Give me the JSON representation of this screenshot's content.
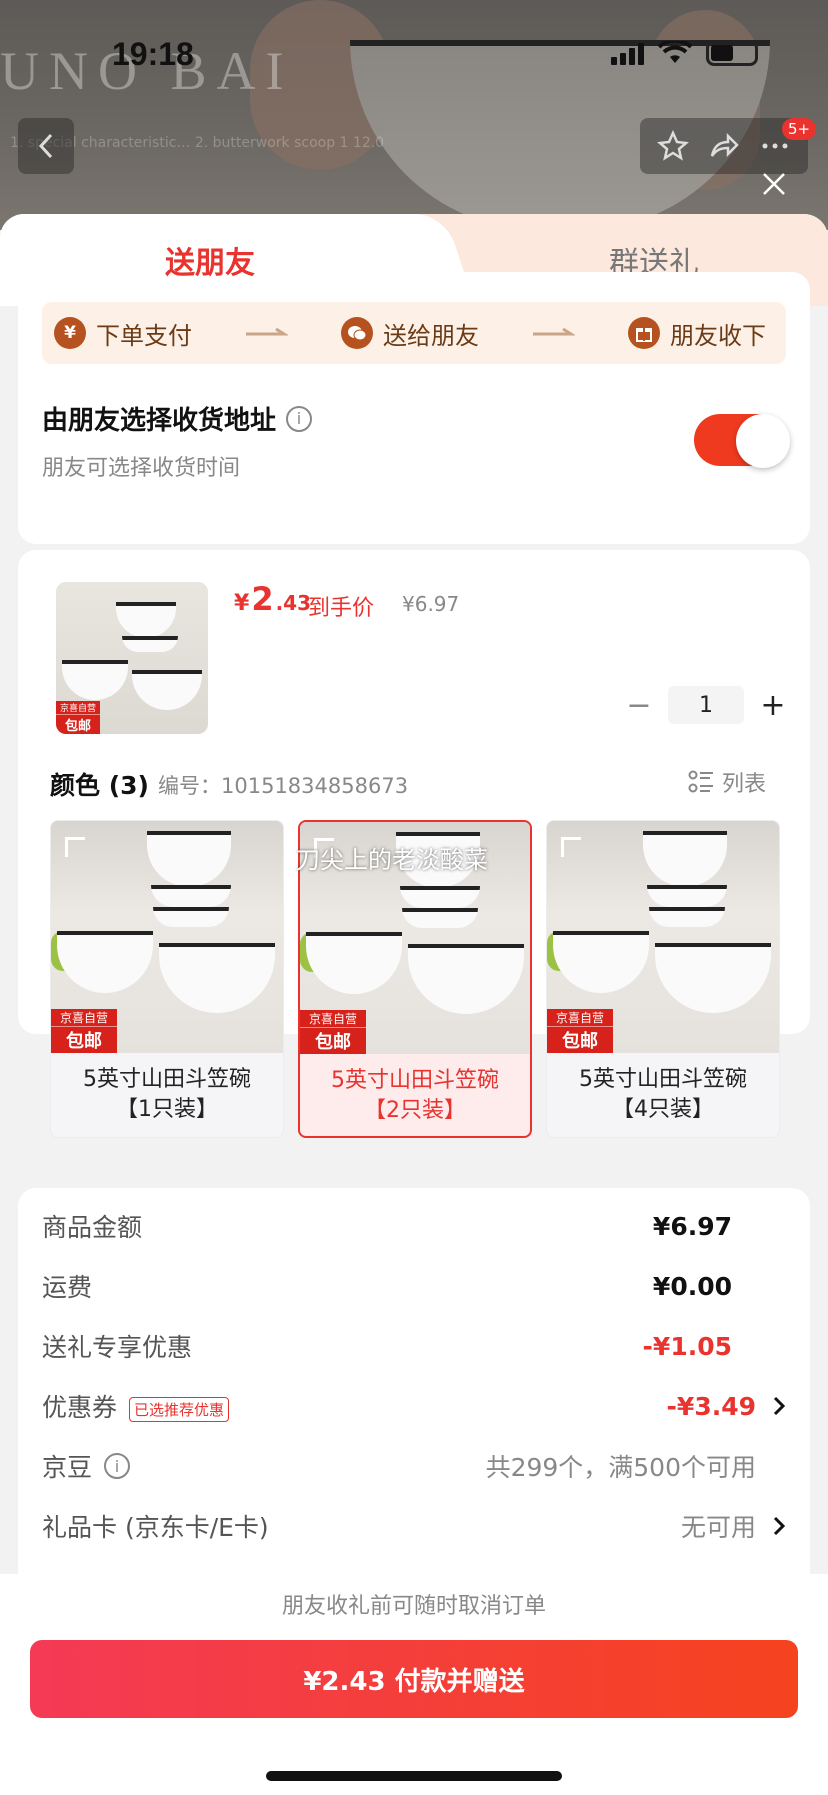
{
  "status_bar": {
    "time": "19:18",
    "battery": "36"
  },
  "background": {
    "brand_text": "UNO BAI",
    "sub_text": "1. special characteristic…  2. butterwork scoop  1  12.0"
  },
  "nav": {
    "badge": "5+"
  },
  "tabs": [
    {
      "label": "送朋友",
      "active": true
    },
    {
      "label": "群送礼",
      "active": false
    }
  ],
  "steps": [
    {
      "icon": "yen-icon",
      "glyph": "¥",
      "label": "下单支付"
    },
    {
      "icon": "wechat-icon",
      "glyph": "◕",
      "label": "送给朋友"
    },
    {
      "icon": "gift-icon",
      "glyph": "▣",
      "label": "朋友收下"
    }
  ],
  "address": {
    "title": "由朋友选择收货地址",
    "info_glyph": "i",
    "subtitle": "朋友可选择收货时间",
    "toggle_on": true
  },
  "product": {
    "thumb_tag_top": "京喜自营",
    "thumb_tag_bottom": "包邮",
    "price_symbol": "¥",
    "price_int": "2",
    "price_dec": ".43",
    "price_label": "到手价",
    "original_price": "¥6.97",
    "quantity": "1",
    "minus": "−",
    "plus": "+",
    "color_label": "颜色 (3)",
    "sku_number": "编号：10151834858673",
    "list_view_label": "列表",
    "overlay_caption": "刀尖上的老淡酸菜",
    "options": [
      {
        "name_line1": "5英寸山田斗笠碗",
        "name_line2": "【1只装】",
        "selected": false,
        "tag_top": "京喜自营",
        "tag_bottom": "包邮"
      },
      {
        "name_line1": "5英寸山田斗笠碗",
        "name_line2": "【2只装】",
        "selected": true,
        "tag_top": "京喜自营",
        "tag_bottom": "包邮"
      },
      {
        "name_line1": "5英寸山田斗笠碗",
        "name_line2": "【4只装】",
        "selected": false,
        "tag_top": "京喜自营",
        "tag_bottom": "包邮"
      }
    ]
  },
  "summary": {
    "goods_amount": {
      "label": "商品金额",
      "value": "¥6.97"
    },
    "shipping": {
      "label": "运费",
      "value": "¥0.00"
    },
    "gift_discount": {
      "label": "送礼专享优惠",
      "value": "-¥1.05"
    },
    "coupon": {
      "label": "优惠券",
      "tag": "已选推荐优惠",
      "value": "-¥3.49"
    },
    "jingdou": {
      "label": "京豆",
      "info_glyph": "i",
      "value": "共299个，满500个可用"
    },
    "gift_card": {
      "label": "礼品卡 (京东卡/E卡)",
      "value": "无可用"
    }
  },
  "footer": {
    "cancel_tip": "朋友收礼前可随时取消订单",
    "pay_button": "¥2.43 付款并赠送"
  },
  "colors": {
    "accent": "#e8332f",
    "toggle": "#f03a1f",
    "step_icon": "#b5521f"
  }
}
